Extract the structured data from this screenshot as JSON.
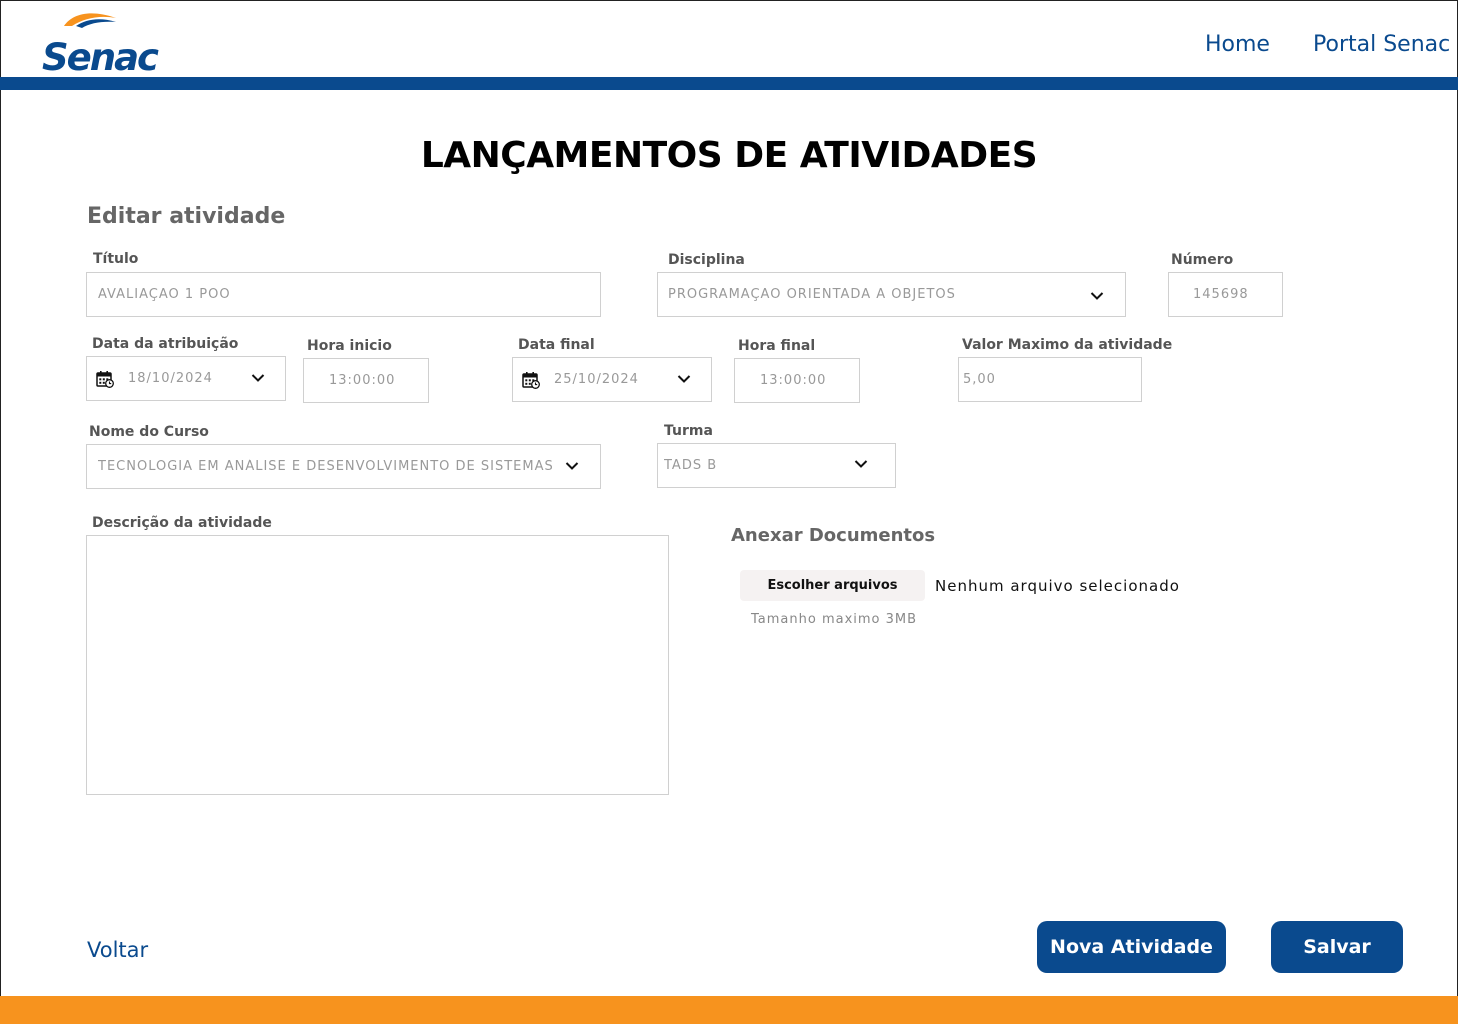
{
  "header": {
    "logo_text": "Senac",
    "nav": {
      "home": "Home",
      "portal": "Portal Senac"
    }
  },
  "page": {
    "title": "LANÇAMENTOS DE ATIVIDADES",
    "section_title": "Editar atividade"
  },
  "form": {
    "titulo": {
      "label": "Título",
      "value": "AVALIAÇÃO 1 POO"
    },
    "disciplina": {
      "label": "Disciplina",
      "value": "PROGRAMAÇÃO ORIENTADA A OBJETOS"
    },
    "numero": {
      "label": "Número",
      "value": "145698"
    },
    "data_atribuicao": {
      "label": "Data da atribuição",
      "value": "18/10/2024"
    },
    "hora_inicio": {
      "label": "Hora inicio",
      "value": "13:00:00"
    },
    "data_final": {
      "label": "Data final",
      "value": "25/10/2024"
    },
    "hora_final": {
      "label": "Hora final",
      "value": "13:00:00"
    },
    "valor_maximo": {
      "label": "Valor Maximo da atividade",
      "value": "5,00"
    },
    "nome_curso": {
      "label": "Nome do Curso",
      "value": "TECNOLOGIA EM ANÁLISE E DESENVOLVIMENTO DE SISTEMAS"
    },
    "turma": {
      "label": "Turma",
      "value": "TADS B"
    },
    "descricao": {
      "label": "Descrição da atividade",
      "value": ""
    }
  },
  "anexos": {
    "title": "Anexar Documentos",
    "choose_button": "Escolher arquivos",
    "no_file": "Nenhum arquivo selecionado",
    "hint": "Tamanho maximo 3MB"
  },
  "actions": {
    "voltar": "Voltar",
    "nova_atividade": "Nova Atividade",
    "salvar": "Salvar"
  },
  "colors": {
    "primary": "#0a4a8e",
    "accent": "#f7931e"
  },
  "icons": [
    "calendar-icon",
    "chevron-down-icon"
  ]
}
